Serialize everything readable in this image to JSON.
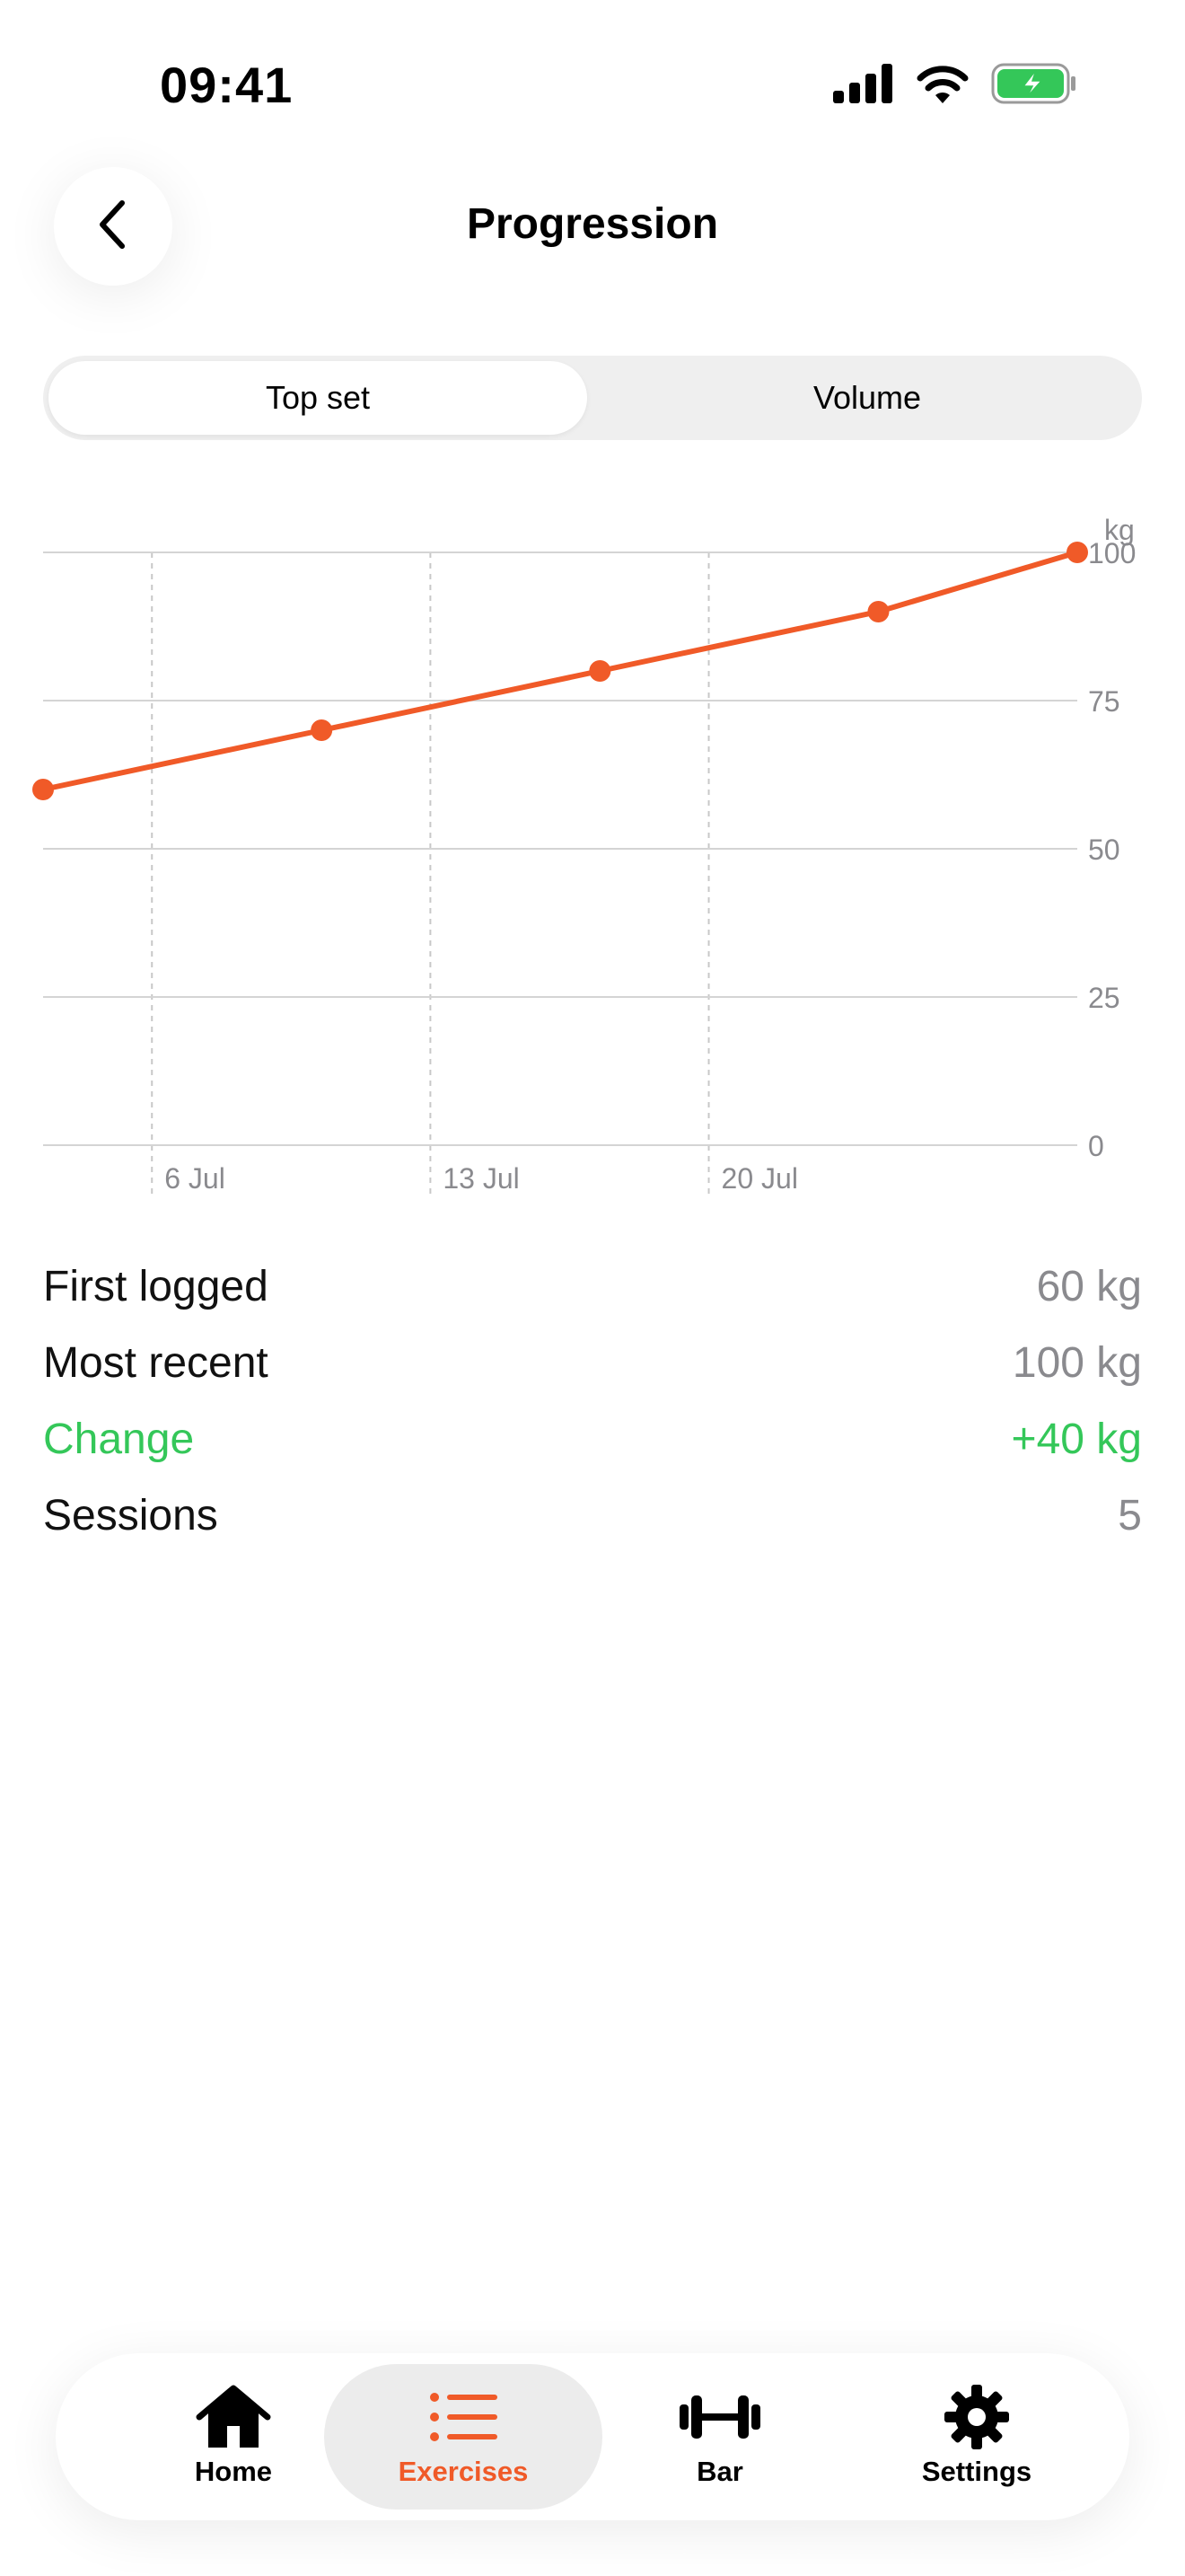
{
  "status_bar": {
    "time": "09:41"
  },
  "header": {
    "title": "Progression"
  },
  "segmented": {
    "options": [
      "Top set",
      "Volume"
    ],
    "selected": "Top set"
  },
  "chart_data": {
    "type": "line",
    "unit_label": "kg",
    "x_tick_labels": [
      "6 Jul",
      "13 Jul",
      "20 Jul"
    ],
    "x": [
      "2 Jul",
      "9 Jul",
      "16 Jul",
      "23 Jul",
      "28 Jul"
    ],
    "series": [
      {
        "values": [
          60,
          70,
          80,
          90,
          100
        ]
      }
    ],
    "y_ticks": [
      0,
      25,
      50,
      75,
      100
    ],
    "ylim": [
      0,
      100
    ],
    "grid": true,
    "line_color": "#f05a28"
  },
  "stats": {
    "rows": [
      {
        "label": "First logged",
        "value": "60 kg"
      },
      {
        "label": "Most recent",
        "value": "100 kg"
      },
      {
        "label": "Change",
        "value": "+40 kg"
      },
      {
        "label": "Sessions",
        "value": "5"
      }
    ]
  },
  "tab_bar": {
    "tabs": [
      {
        "label": "Home",
        "icon": "house-icon"
      },
      {
        "label": "Exercises",
        "icon": "list-icon"
      },
      {
        "label": "Bar",
        "icon": "barbell-icon"
      },
      {
        "label": "Settings",
        "icon": "gear-icon"
      }
    ],
    "selected": "Exercises",
    "accent_color": "#f05a28"
  }
}
